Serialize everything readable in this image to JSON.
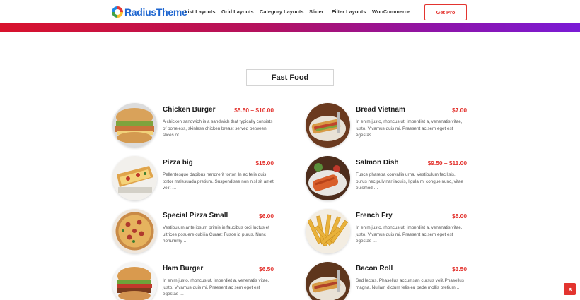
{
  "header": {
    "brand": "RadiusTheme",
    "nav": [
      "List Layouts",
      "Grid Layouts",
      "Category Layouts",
      "Slider",
      "Filter Layouts",
      "WooCommerce"
    ],
    "cta": "Get Pro"
  },
  "section": {
    "title": "Fast Food"
  },
  "menu": [
    {
      "name": "Chicken Burger",
      "price": "$5.50 – $10.00",
      "desc": "A chicken sandwich is a sandwich that typically consists of boneless, skinless chicken breast served between slices of …",
      "icon": "burger-image"
    },
    {
      "name": "Bread Vietnam",
      "price": "$7.00",
      "desc": "In enim justo, rhoncus ut, imperdiet a, venenatis vitae, justo. Vivamus quis mi. Praesent ac sem eget est egestas …",
      "icon": "bread-image"
    },
    {
      "name": "Pizza big",
      "price": "$15.00",
      "desc": "Pellentesque dapibus hendrerit tortor. In ac felis quis tortor malesuada pretium. Suspendisse non nisl sit amet velit …",
      "icon": "pizza-slice-image"
    },
    {
      "name": "Salmon Dish",
      "price": "$9.50 – $11.00",
      "desc": "Fusce pharetra convallis urna. Vestibulum facilisis, purus nec pulvinar iaculis, ligula mi congue nunc, vitae euismod …",
      "icon": "salmon-image"
    },
    {
      "name": "Special Pizza Small",
      "price": "$6.00",
      "desc": "Vestibulum ante ipsum primis in faucibus orci luctus et ultrices posuere cubilia Curae; Fusce id purus. Nunc nonummy …",
      "icon": "pizza-image"
    },
    {
      "name": "French Fry",
      "price": "$5.00",
      "desc": "In enim justo, rhoncus ut, imperdiet a, venenatis vitae, justo. Vivamus quis mi. Praesent ac sem eget est egestas …",
      "icon": "fries-image"
    },
    {
      "name": "Ham Burger",
      "price": "$6.50",
      "desc": "In enim justo, rhoncus ut, imperdiet a, venenatis vitae, justo. Vivamus quis mi. Praesent ac sem eget est egestas …",
      "icon": "hamburger-image"
    },
    {
      "name": "Bacon Roll",
      "price": "$3.50",
      "desc": "Sed lectus. Phasellus accumsan cursus velit.Phasellus magna. Nullam dictum felis eu pede mollis pretium …",
      "icon": "bacon-roll-image"
    }
  ],
  "scroll_top": "»",
  "colors": {
    "accent": "#e3342f",
    "brand": "#1e66d0",
    "gradient_start": "#d8122c",
    "gradient_end": "#7a1bd6"
  }
}
